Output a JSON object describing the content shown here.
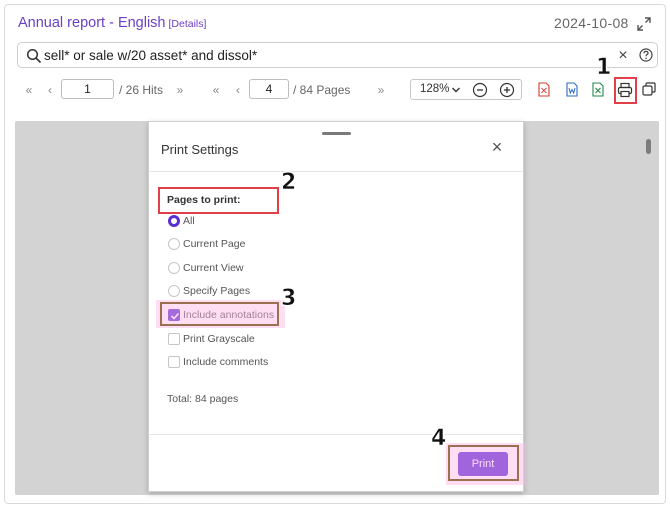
{
  "header": {
    "title": "Annual report - English",
    "details_link": "[Details]",
    "date": "2024-10-08"
  },
  "search": {
    "value": "sell* or sale w/20 asset* and dissol*"
  },
  "toolbar": {
    "hit_current": "1",
    "hit_total": "/ 26 Hits",
    "page_current": "4",
    "page_total": "/ 84 Pages",
    "zoom": "128%",
    "file_icons": [
      "pdf-icon",
      "word-icon",
      "excel-icon"
    ]
  },
  "dialog": {
    "title": "Print Settings",
    "section_label": "Pages to print:",
    "page_options": [
      {
        "label": "All",
        "checked": true
      },
      {
        "label": "Current Page",
        "checked": false
      },
      {
        "label": "Current View",
        "checked": false
      },
      {
        "label": "Specify Pages",
        "checked": false
      }
    ],
    "checkbox_options": [
      {
        "label": "Include annotations",
        "checked": true
      },
      {
        "label": "Print Grayscale",
        "checked": false
      },
      {
        "label": "Include comments",
        "checked": false
      }
    ],
    "total": "Total: 84 pages",
    "print_button": "Print"
  },
  "annotations": {
    "steps": [
      "1",
      "2",
      "3",
      "4"
    ]
  },
  "colors": {
    "accent": "#5321d6",
    "title": "#6b3fc6",
    "highlight_red": "#e0404a",
    "highlight_brown": "#9a7050",
    "viewer_bg": "#d3d3d3"
  }
}
